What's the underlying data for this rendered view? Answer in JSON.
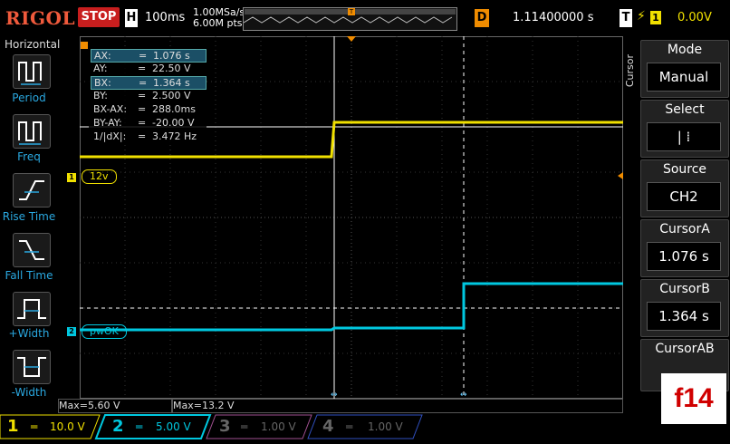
{
  "header": {
    "logo": "RIGOL",
    "run_state": "STOP",
    "timebase_label": "H",
    "timebase": "100ms",
    "sample_rate": "1.00MSa/s",
    "mem_depth": "6.00M pts",
    "trigger_pos_marker": "T",
    "delay_label": "D",
    "delay": "1.11400000 s",
    "trigger_label": "T",
    "trigger_edge_icon": "rising-edge-icon",
    "trigger_channel": "1",
    "trigger_level": "0.00V"
  },
  "left_menu": {
    "title": "Horizontal",
    "items": [
      {
        "label": "Period",
        "icon": "period-icon"
      },
      {
        "label": "Freq",
        "icon": "freq-icon"
      },
      {
        "label": "Rise Time",
        "icon": "rise-time-icon"
      },
      {
        "label": "Fall Time",
        "icon": "fall-time-icon"
      },
      {
        "label": "+Width",
        "icon": "pos-width-icon"
      },
      {
        "label": "-Width",
        "icon": "neg-width-icon"
      }
    ]
  },
  "cursor_readout": {
    "rows": [
      {
        "key": "AX:",
        "eq": "=",
        "val": "1.076 s",
        "highlight": true
      },
      {
        "key": "AY:",
        "eq": "=",
        "val": "22.50 V",
        "highlight": false
      },
      {
        "key": "BX:",
        "eq": "=",
        "val": "1.364 s",
        "highlight": true
      },
      {
        "key": "BY:",
        "eq": "=",
        "val": "2.500 V",
        "highlight": false
      },
      {
        "key": "BX-AX:",
        "eq": "=",
        "val": "288.0ms",
        "highlight": false
      },
      {
        "key": "BY-AY:",
        "eq": "=",
        "val": "-20.00 V",
        "highlight": false
      },
      {
        "key": "1/|dX|:",
        "eq": "=",
        "val": "3.472 Hz",
        "highlight": false
      }
    ]
  },
  "channels_on_screen": {
    "ch1_num": "1",
    "ch1_tag": "12v",
    "ch2_num": "2",
    "ch2_tag": "pwOK",
    "ch1_color": "#f0e000",
    "ch2_color": "#00c8e0"
  },
  "right_menu": {
    "side_label": "Cursor",
    "mode_title": "Mode",
    "mode_value": "Manual",
    "select_title": "Select",
    "select_value": "| ⁞",
    "source_title": "Source",
    "source_value": "CH2",
    "cursora_title": "CursorA",
    "cursora_value": "1.076 s",
    "cursorb_title": "CursorB",
    "cursorb_value": "1.364 s",
    "cursorab_title": "CursorAB"
  },
  "bottom_measure": {
    "left": "Max=5.60 V",
    "right": "Max=13.2 V"
  },
  "bottom_bar": {
    "ch1_num": "1",
    "ch1_coupling": "═",
    "ch1_scale": "10.0 V",
    "ch2_num": "2",
    "ch2_coupling": "═",
    "ch2_scale": "5.00 V",
    "ch3_num": "3",
    "ch3_coupling": "═",
    "ch3_scale": "1.00 V",
    "ch4_num": "4",
    "ch4_coupling": "═",
    "ch4_scale": "1.00 V"
  },
  "overlay_label": "f14"
}
